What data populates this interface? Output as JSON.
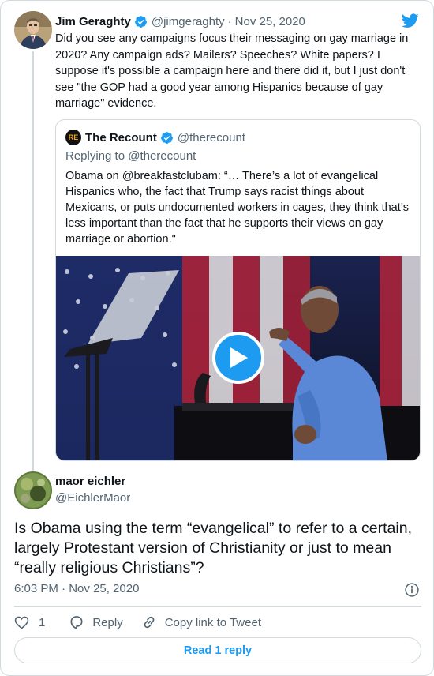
{
  "parent_tweet": {
    "author_name": "Jim Geraghty",
    "handle": "@jimgeraghty",
    "separator": "·",
    "date": "Nov 25, 2020",
    "text": "Did you see any campaigns focus their messaging on gay marriage in 2020? Any campaign ads? Mailers? Speeches? White papers? I suppose it's possible a campaign here and there did it, but I just don't see \"the GOP had a good year among Hispanics because of gay marriage\" evidence."
  },
  "quoted_tweet": {
    "avatar_text": "RE",
    "author_name": "The Recount",
    "handle": "@therecount",
    "replying_to": "Replying to @therecount",
    "text": "Obama on @breakfastclubam: “… There’s a lot of evangelical Hispanics who, the fact that Trump says racist things about Mexicans, or puts undocumented workers in cages, they think that’s less important than the fact that he supports their views on gay marriage or abortion.\""
  },
  "reply_tweet": {
    "author_name": "maor eichler",
    "handle": "@EichlerMaor",
    "text": "Is Obama using the term “evangelical” to refer to a certain, largely Protestant version of Christianity or just to mean “really religious Christians”?",
    "timestamp": "6:03 PM · Nov 25, 2020"
  },
  "actions": {
    "like_count": "1",
    "reply_label": "Reply",
    "copy_link_label": "Copy link to Tweet"
  },
  "read_replies_label": "Read 1 reply",
  "colors": {
    "accent": "#1d9bf0",
    "text_primary": "#0f1419",
    "text_secondary": "#536471",
    "border": "#cfd9de"
  },
  "icons": [
    "twitter-logo-icon",
    "verified-badge-icon",
    "play-icon",
    "info-icon",
    "heart-icon",
    "reply-icon",
    "link-icon"
  ]
}
